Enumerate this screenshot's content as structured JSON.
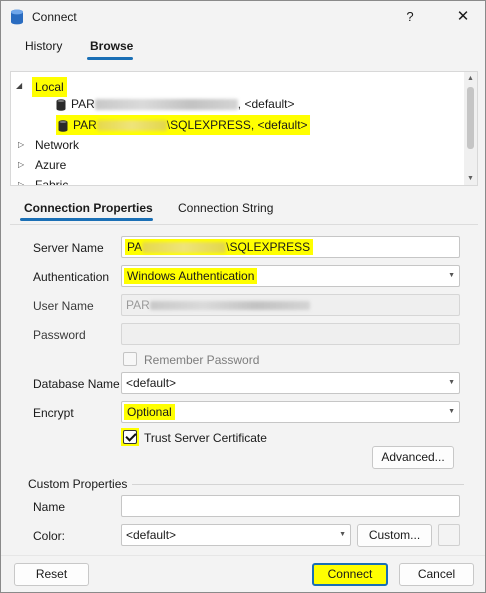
{
  "window": {
    "title": "Connect",
    "help_glyph": "?",
    "close_glyph": "✕"
  },
  "top_tabs": {
    "history": "History",
    "browse": "Browse"
  },
  "tree": {
    "local_label": "Local",
    "server1_prefix": "PAR",
    "server1_suffix": ", <default>",
    "server2_prefix": "PAR",
    "server2_suffix": "\\SQLEXPRESS, <default>",
    "network_label": "Network",
    "azure_label": "Azure",
    "fabric_label": "Fabric"
  },
  "lower_tabs": {
    "properties": "Connection Properties",
    "connection_string": "Connection String"
  },
  "form": {
    "server_name_label": "Server Name",
    "server_name_prefix": "PA",
    "server_name_suffix": "\\SQLEXPRESS",
    "auth_label": "Authentication",
    "auth_value": "Windows Authentication",
    "username_label": "User Name",
    "username_prefix": "PAR",
    "password_label": "Password",
    "remember_password_label": "Remember Password",
    "database_label": "Database Name",
    "database_value": "<default>",
    "encrypt_label": "Encrypt",
    "encrypt_value": "Optional",
    "trust_cert_label": "Trust Server Certificate",
    "advanced_button": "Advanced..."
  },
  "custom": {
    "group_title": "Custom Properties",
    "name_label": "Name",
    "color_label": "Color:",
    "color_value": "<default>",
    "custom_button": "Custom..."
  },
  "footer": {
    "reset": "Reset",
    "connect": "Connect",
    "cancel": "Cancel"
  },
  "colors": {
    "accent": "#1a6fb5",
    "highlight": "#ffff00",
    "db_icon": "#2a2a2a"
  },
  "state": {
    "trust_server_certificate": true,
    "remember_password": false
  }
}
